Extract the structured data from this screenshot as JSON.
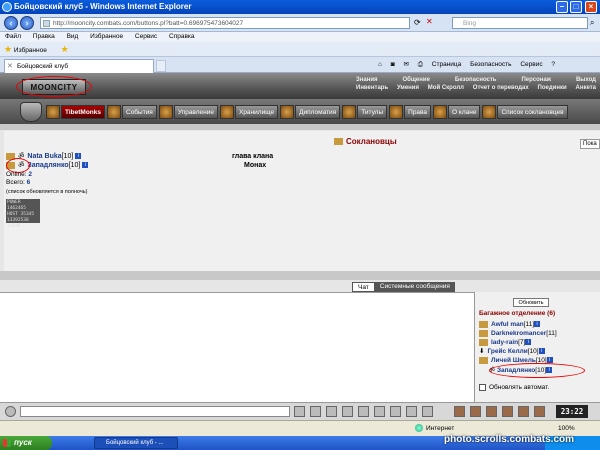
{
  "window": {
    "title": "Бойцовский клуб - Windows Internet Explorer"
  },
  "address": {
    "url": "http://mooncity.combats.com/buttons.pl?batt=0.696975473604027",
    "search_placeholder": "Bing"
  },
  "menu": [
    "Файл",
    "Правка",
    "Вид",
    "Избранное",
    "Сервис",
    "Справка"
  ],
  "favorites": {
    "label": "Избранное"
  },
  "tab": {
    "label": "Бойцовский клуб"
  },
  "toolbar": {
    "items": [
      "Страница",
      "Безопасность",
      "Сервис"
    ]
  },
  "game": {
    "logo": "MOONCITY",
    "toplinks_row1": [
      "Знания",
      "Общение",
      "Безопасность",
      "Персонаж",
      "Выход"
    ],
    "toplinks_row2": [
      "Инвентарь",
      "Умения",
      "Мой Скролл",
      "Отчет о переводах",
      "Поединки",
      "Анкета"
    ],
    "nav": [
      "TibetMonks",
      "События",
      "Управление",
      "Хранилище",
      "Дипломатия",
      "Титулы",
      "Права",
      "О клане",
      "Список соклановцев"
    ],
    "panel_title": "Соклановцы",
    "pok_label": "Пока",
    "members": [
      {
        "nick": "Nata Buka",
        "level": "[10]",
        "role": "глава клана"
      },
      {
        "nick": "Западлянко",
        "level": "[10]",
        "role": "Монах"
      }
    ],
    "online_label": "Online:",
    "online_value": "2",
    "total_label": "Всего:",
    "total_value": "6",
    "note": "(список обновляется в полночь)",
    "counter_lines": [
      "POWER 1462465",
      "HOST 35345",
      "13392538",
      "41096"
    ],
    "chat_tabs": [
      "Чат",
      "Системные сообщения"
    ],
    "refresh_label": "Обновить",
    "room_title": "Багажное отделение (6)",
    "online_users": [
      {
        "nick": "Awful man",
        "level": "[11]"
      },
      {
        "nick": "Darknekromancer",
        "level": "[11]"
      },
      {
        "nick": "lady-rain",
        "level": "[7]"
      },
      {
        "nick": "Грейс Келли",
        "level": "[10]"
      },
      {
        "nick": "Личей Шмель",
        "level": "[10]"
      },
      {
        "nick": "Западлянко",
        "level": "[10]"
      }
    ],
    "auto_label": "Обновлять автомат.",
    "clock": "23:22"
  },
  "status": {
    "zone": "Интернет",
    "zoom": "100%"
  },
  "taskbar": {
    "start": "пуск",
    "item": "Бойцовский клуб - ..."
  },
  "watermark": "photo.scrolls.combats.com"
}
